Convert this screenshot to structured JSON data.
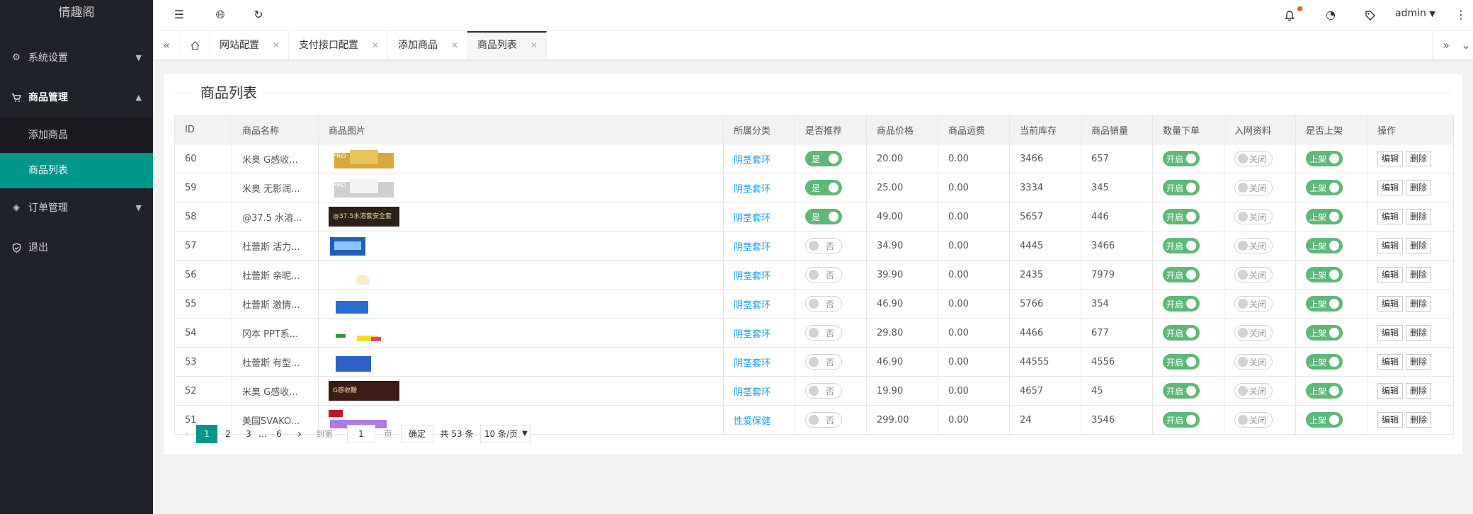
{
  "app": {
    "title": "情趣阁"
  },
  "sidebar": {
    "items": [
      {
        "label": "系统设置",
        "icon": "gear-icon"
      },
      {
        "label": "商品管理",
        "icon": "cart-icon"
      },
      {
        "label": "订单管理",
        "icon": "layers-icon"
      },
      {
        "label": "退出",
        "icon": "shield-icon"
      }
    ],
    "sub": [
      {
        "label": "添加商品"
      },
      {
        "label": "商品列表"
      }
    ]
  },
  "header": {
    "user": "admin"
  },
  "tabs": [
    {
      "label": "网站配置"
    },
    {
      "label": "支付接口配置"
    },
    {
      "label": "添加商品"
    },
    {
      "label": "商品列表"
    }
  ],
  "page": {
    "title": "商品列表"
  },
  "table": {
    "columns": [
      "ID",
      "商品名称",
      "商品图片",
      "所属分类",
      "是否推荐",
      "商品价格",
      "商品运费",
      "当前库存",
      "商品销量",
      "数量下单",
      "入网资料",
      "是否上架",
      "操作"
    ],
    "rows": [
      {
        "id": "60",
        "name": "米奥 G感收...",
        "image_text": "PRO",
        "category": "阴茎套环",
        "recommend": "是",
        "price": "20.00",
        "shipping": "0.00",
        "stock": "3466",
        "sales": "657",
        "qty": "开启",
        "info": "关闭",
        "listed": "上架"
      },
      {
        "id": "59",
        "name": "米奥 无影润...",
        "image_text": "PRO",
        "category": "阴茎套环",
        "recommend": "是",
        "price": "25.00",
        "shipping": "0.00",
        "stock": "3334",
        "sales": "345",
        "qty": "开启",
        "info": "关闭",
        "listed": "上架"
      },
      {
        "id": "58",
        "name": "@37.5 水溶...",
        "image_text": "@37.5水溶套安全套",
        "category": "阴茎套环",
        "recommend": "是",
        "price": "49.00",
        "shipping": "0.00",
        "stock": "5657",
        "sales": "446",
        "qty": "开启",
        "info": "关闭",
        "listed": "上架"
      },
      {
        "id": "57",
        "name": "杜蕾斯 活力...",
        "image_text": "",
        "category": "阴茎套环",
        "recommend": "否",
        "price": "34.90",
        "shipping": "0.00",
        "stock": "4445",
        "sales": "3466",
        "qty": "开启",
        "info": "关闭",
        "listed": "上架"
      },
      {
        "id": "56",
        "name": "杜蕾斯 亲昵...",
        "image_text": "",
        "category": "阴茎套环",
        "recommend": "否",
        "price": "39.90",
        "shipping": "0.00",
        "stock": "2435",
        "sales": "7979",
        "qty": "开启",
        "info": "关闭",
        "listed": "上架"
      },
      {
        "id": "55",
        "name": "杜蕾斯 激情...",
        "image_text": "",
        "category": "阴茎套环",
        "recommend": "否",
        "price": "46.90",
        "shipping": "0.00",
        "stock": "5766",
        "sales": "354",
        "qty": "开启",
        "info": "关闭",
        "listed": "上架"
      },
      {
        "id": "54",
        "name": "冈本 PPT系...",
        "image_text": "",
        "category": "阴茎套环",
        "recommend": "否",
        "price": "29.80",
        "shipping": "0.00",
        "stock": "4466",
        "sales": "677",
        "qty": "开启",
        "info": "关闭",
        "listed": "上架"
      },
      {
        "id": "53",
        "name": "杜蕾斯 有型...",
        "image_text": "",
        "category": "阴茎套环",
        "recommend": "否",
        "price": "46.90",
        "shipping": "0.00",
        "stock": "44555",
        "sales": "4556",
        "qty": "开启",
        "info": "关闭",
        "listed": "上架"
      },
      {
        "id": "52",
        "name": "米奥 G感收...",
        "image_text": "G感收鞭",
        "category": "阴茎套环",
        "recommend": "否",
        "price": "19.90",
        "shipping": "0.00",
        "stock": "4657",
        "sales": "45",
        "qty": "开启",
        "info": "关闭",
        "listed": "上架"
      },
      {
        "id": "51",
        "name": "美国SVAKO...",
        "image_text": "",
        "category": "性爱保健",
        "recommend": "否",
        "price": "299.00",
        "shipping": "0.00",
        "stock": "24",
        "sales": "3546",
        "qty": "开启",
        "info": "关闭",
        "listed": "上架"
      }
    ],
    "actions": {
      "edit": "编辑",
      "delete": "删除"
    }
  },
  "pagination": {
    "pages": [
      "1",
      "2",
      "3",
      "…",
      "6"
    ],
    "goto_label": "到第",
    "goto_value": "1",
    "page_unit": "页",
    "confirm": "确定",
    "total": "共 53 条",
    "page_size": "10 条/页"
  },
  "colors": {
    "accent": "#009688",
    "switch_on": "#5fb878",
    "sidebar_bg": "#20222a",
    "price": "#ff5722",
    "stock": "#ff2a2a",
    "link": "#1e9fff"
  }
}
